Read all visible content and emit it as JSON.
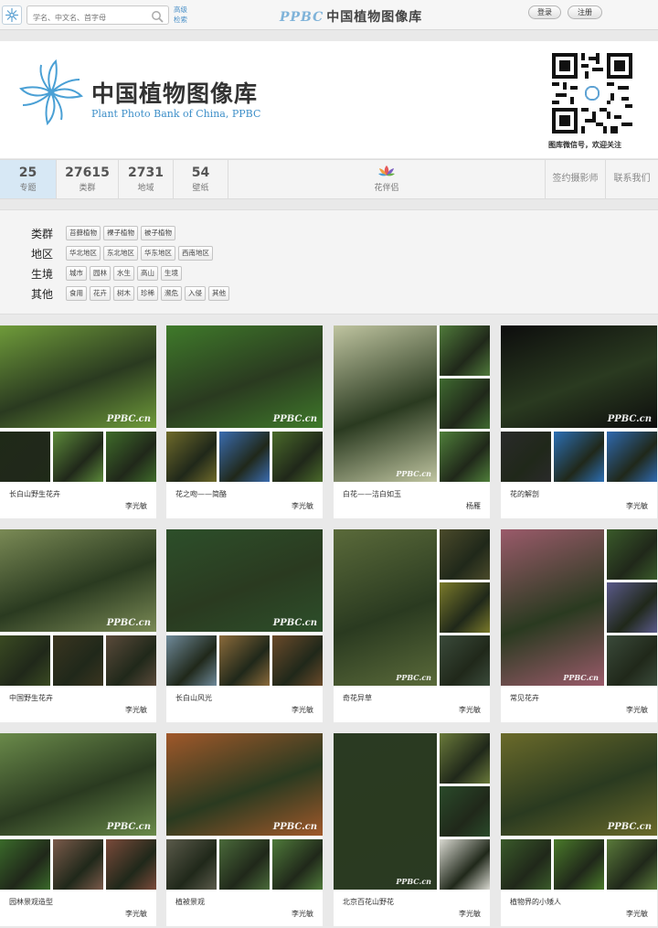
{
  "topbar": {
    "search_placeholder": "学名、中文名、首字母",
    "advanced_search": "高级检索",
    "brand": "PPBC",
    "site_name": "中国植物图像库",
    "login": "登录",
    "register": "注册"
  },
  "header": {
    "title_cn": "中国植物图像库",
    "title_en": "Plant Photo Bank of China, PPBC",
    "qr_caption": "图库微信号，欢迎关注"
  },
  "stats": [
    {
      "num": "25",
      "label": "专题"
    },
    {
      "num": "27615",
      "label": "类群"
    },
    {
      "num": "2731",
      "label": "地域"
    },
    {
      "num": "54",
      "label": "壁纸"
    }
  ],
  "flower_partner": "花伴侣",
  "links": {
    "photographer": "签约摄影师",
    "contact": "联系我们"
  },
  "filters": [
    {
      "name": "类群",
      "tags": [
        "苔藓植物",
        "裸子植物",
        "被子植物"
      ]
    },
    {
      "name": "地区",
      "tags": [
        "华北地区",
        "东北地区",
        "华东地区",
        "西南地区"
      ]
    },
    {
      "name": "生境",
      "tags": [
        "城市",
        "园林",
        "水生",
        "高山",
        "生境"
      ]
    },
    {
      "name": "其他",
      "tags": [
        "食用",
        "花卉",
        "树木",
        "珍稀",
        "濒危",
        "入侵",
        "其他"
      ]
    }
  ],
  "watermark": "PPBC.cn",
  "cards": [
    {
      "title": "长白山野生花卉",
      "author": "李光敏",
      "layout": "h",
      "colors": [
        "#6f9b3a",
        "#1f2a18",
        "#5c8a3a",
        "#3f6b2a"
      ]
    },
    {
      "title": "花之吻——简酪",
      "author": "李光敏",
      "layout": "h",
      "colors": [
        "#3f7a2a",
        "#6e6a2a",
        "#3a6cb0",
        "#4a6a2a"
      ]
    },
    {
      "title": "白花——洁白如玉",
      "author": "杨雁",
      "layout": "v",
      "colors": [
        "#bfc4a0",
        "#4f7a3a",
        "#3f6a30",
        "#4f7f3a"
      ]
    },
    {
      "title": "花的解剖",
      "author": "李光敏",
      "layout": "h",
      "colors": [
        "#0d0d0d",
        "#2a2a2a",
        "#2c6fb5",
        "#2f6ab0"
      ]
    },
    {
      "title": "中国野生花卉",
      "author": "李光敏",
      "layout": "h",
      "colors": [
        "#7a8a55",
        "#3a4a22",
        "#3a3520",
        "#5a4a3a"
      ]
    },
    {
      "title": "长白山风光",
      "author": "李光敏",
      "layout": "h",
      "colors": [
        "#2d4f2a",
        "#6f8a9a",
        "#8a6a3a",
        "#6a4a2a"
      ]
    },
    {
      "title": "奇花异草",
      "author": "李光敏",
      "layout": "v",
      "colors": [
        "#5a6a3a",
        "#4a4a2a",
        "#7a7a2a",
        "#3a4a3a"
      ]
    },
    {
      "title": "常见花卉",
      "author": "李光敏",
      "layout": "v",
      "colors": [
        "#9a5a6a",
        "#3a5a2a",
        "#5a5a8a",
        "#3a4a3a"
      ]
    },
    {
      "title": "园林景观造型",
      "author": "李光敏",
      "layout": "h",
      "colors": [
        "#6a8a4a",
        "#3a6a2a",
        "#7a5a4a",
        "#7a4a3a"
      ]
    },
    {
      "title": "植被景观",
      "author": "李光敏",
      "layout": "h",
      "colors": [
        "#a0582a",
        "#5a5a4a",
        "#4a6a3a",
        "#4f7a3a"
      ]
    },
    {
      "title": "北京百花山野花",
      "author": "李光敏",
      "layout": "v",
      "colors": [
        "#2a3a22",
        "#6a7a3a",
        "#2a4a2a",
        "#d8d8d0"
      ]
    },
    {
      "title": "植物界的小矮人",
      "author": "李光敏",
      "layout": "h",
      "colors": [
        "#6a6a2a",
        "#3a5a2a",
        "#4a7a2a",
        "#5a7a3a"
      ]
    }
  ]
}
